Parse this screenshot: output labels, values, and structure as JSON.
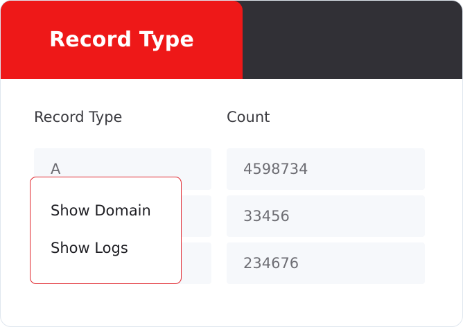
{
  "tabs": {
    "active_label": "Record Type",
    "inactive_label": ""
  },
  "table": {
    "columns": [
      "Record Type",
      "Count"
    ],
    "rows": [
      {
        "record_type": "A",
        "count": "4598734"
      },
      {
        "record_type": "",
        "count": "33456"
      },
      {
        "record_type": "",
        "count": "234676"
      }
    ]
  },
  "context_menu": {
    "items": [
      "Show Domain",
      "Show Logs"
    ]
  },
  "colors": {
    "active_tab": "#ee1818",
    "header_dark": "#313036",
    "menu_border": "#e0252c",
    "cell_bg": "#f6f8fb"
  }
}
